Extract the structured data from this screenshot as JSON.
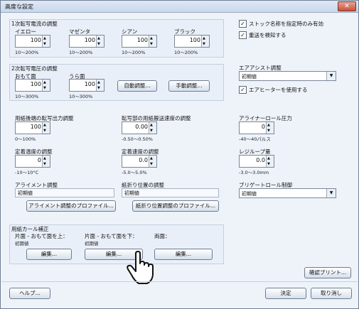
{
  "window": {
    "title": "高度な設定",
    "close": "✕"
  },
  "section1": {
    "title": "1次転写電流の調整",
    "fields": [
      {
        "label": "イエロー",
        "value": "100",
        "range": "10～200%"
      },
      {
        "label": "マゼンタ",
        "value": "100",
        "range": "10～200%"
      },
      {
        "label": "シアン",
        "value": "100",
        "range": "10～200%"
      },
      {
        "label": "ブラック",
        "value": "100",
        "range": "10～200%"
      }
    ]
  },
  "section2": {
    "title": "2次転写電圧の調整",
    "fields": [
      {
        "label": "おもて面",
        "value": "100",
        "range": "10～300%"
      },
      {
        "label": "うら面",
        "value": "100",
        "range": "10～300%"
      }
    ],
    "auto_button": "自動調整...",
    "manual_button": "手動調整..."
  },
  "right_top": {
    "stock_name_only": "ストック名称を指定時のみ有効",
    "double_feed": "重送を検知する",
    "air_assist_label": "エアアシスト調整",
    "air_assist_value": "初期値",
    "air_heater": "エアヒーターを使用する"
  },
  "mid": {
    "paper_end": {
      "label": "用紙後端の転写出力調整",
      "value": "100",
      "range": "0～100%"
    },
    "transfer_speed": {
      "label": "転写部の用紙搬送速度の調整",
      "value": "0.00",
      "range": "-0.50～0.50%"
    },
    "aligner_pressure": {
      "label": "アライナーロール圧力",
      "value": "0",
      "range": "-40～40パルス"
    },
    "fixing_temp": {
      "label": "定着温度の調整",
      "value": "0",
      "range": "-10～10°C"
    },
    "fixing_speed": {
      "label": "定着速度の調整",
      "value": "0.0",
      "range": "-5.0～5.0%"
    },
    "regi_loop": {
      "label": "レジループ量",
      "value": "0.0",
      "range": "-3.0～3.0mm"
    },
    "alignment": {
      "label": "アライメント調整",
      "value": "初期値",
      "button": "アライメント調整のプロファイル..."
    },
    "fold_position": {
      "label": "紙折り位置の調整",
      "value": "初期値",
      "button": "紙折り位置調整のプロファイル..."
    },
    "buckle_roll": {
      "label": "ブリゲートロール制御",
      "value": "初期値"
    }
  },
  "curl": {
    "title": "用紙カール補正",
    "cols": [
      {
        "label": "片面 - おもて面を上：",
        "value": "初期値",
        "button": "編集..."
      },
      {
        "label": "片面 - おもて面を下：",
        "value": "初期値",
        "button": "編集..."
      },
      {
        "label": "両面：",
        "value": "",
        "button": "編集..."
      }
    ]
  },
  "footer": {
    "confirm_print": "確認プリント...",
    "help": "ヘルプ...",
    "ok": "決定",
    "cancel": "取り消し"
  },
  "colors": {
    "accent": "#2f6db8",
    "bg": "#eef3fa",
    "frame": "#6f7f94"
  }
}
